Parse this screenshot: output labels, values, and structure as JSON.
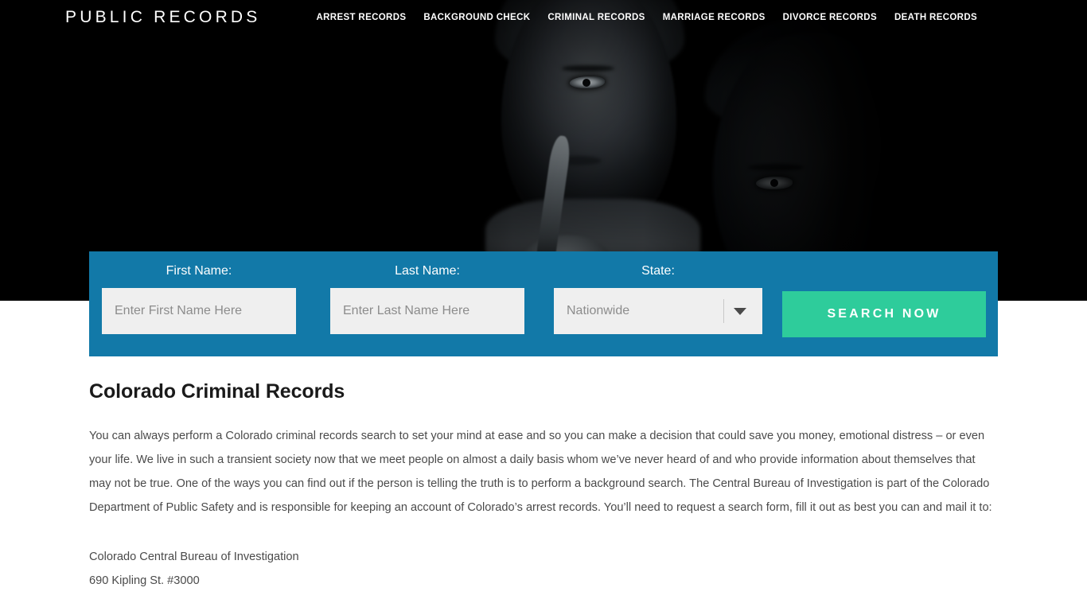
{
  "header": {
    "logo": "PUBLIC RECORDS",
    "nav": [
      {
        "label": "ARREST RECORDS"
      },
      {
        "label": "BACKGROUND CHECK"
      },
      {
        "label": "CRIMINAL RECORDS"
      },
      {
        "label": "MARRIAGE RECORDS"
      },
      {
        "label": "DIVORCE RECORDS"
      },
      {
        "label": "DEATH RECORDS"
      }
    ]
  },
  "hero": {
    "description": "Dark monochrome photograph of a man holding an index finger to his lips in a shushing gesture, with a second shadowed face overlapping at the right"
  },
  "search_form": {
    "panel_color": "#1279a8",
    "first_name": {
      "label": "First Name:",
      "placeholder": "Enter First Name Here",
      "value": ""
    },
    "last_name": {
      "label": "Last Name:",
      "placeholder": "Enter Last Name Here",
      "value": ""
    },
    "state": {
      "label": "State:",
      "selected": "Nationwide",
      "options": [
        "Nationwide"
      ]
    },
    "submit": {
      "label": "SEARCH NOW",
      "color": "#2ecc9b"
    }
  },
  "main": {
    "title": "Colorado Criminal Records",
    "paragraph": "You can always perform a Colorado criminal records search to set your mind at ease and so you can make a decision that could save you money, emotional distress – or even your life. We live in such a transient society now that we meet people on almost a daily basis whom we’ve never heard of and who provide information about themselves that may not be true. One of the ways you can find out if the person is telling the truth is to perform a background search. The Central Bureau of Investigation is part of the Colorado Department of Public Safety and is responsible for keeping an account of Colorado’s arrest records. You’ll need to request a search form, fill it out as best you can and mail it to:",
    "address": {
      "line1": "Colorado Central Bureau of Investigation",
      "line2": "690 Kipling St. #3000"
    }
  }
}
